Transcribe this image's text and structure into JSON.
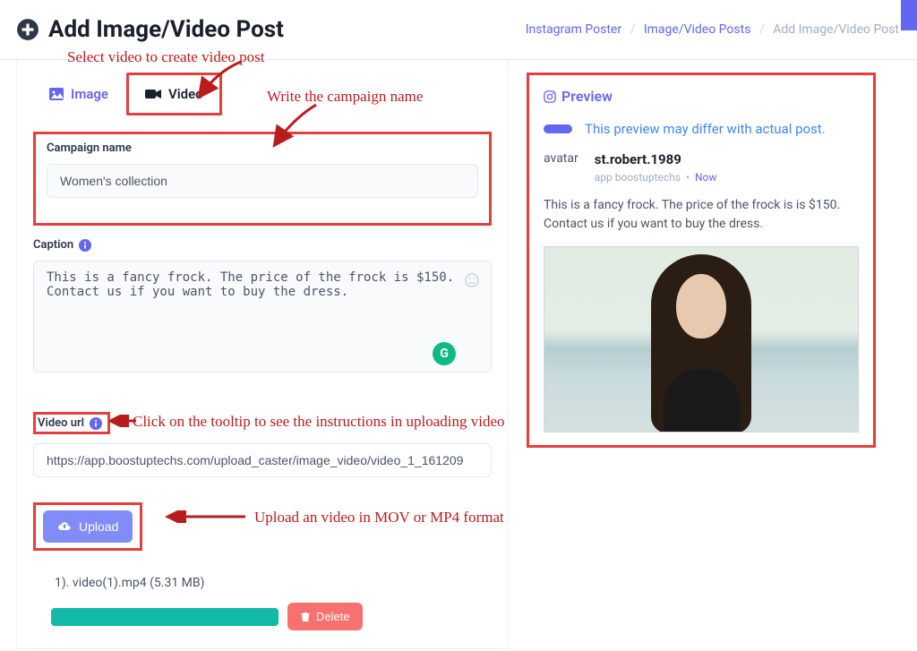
{
  "header": {
    "title": "Add Image/Video Post",
    "breadcrumb": {
      "link1": "Instagram Poster",
      "link2": "Image/Video Posts",
      "current": "Add Image/Video Post"
    }
  },
  "tabs": {
    "image": "Image",
    "video": "Video"
  },
  "form": {
    "campaign_label": "Campaign name",
    "campaign_value": "Women's collection",
    "caption_label": "Caption",
    "caption_value": "This is a fancy frock. The price of the frock is $150. Contact us if you want to buy the dress.",
    "video_url_label": "Video url",
    "video_url_value": "https://app.boostuptechs.com/upload_caster/image_video/video_1_161209",
    "upload_label": "Upload",
    "file_line": "1). video(1).mp4 (5.31 MB)",
    "delete_label": "Delete"
  },
  "preview": {
    "title": "Preview",
    "notice": "This preview may differ with actual post.",
    "avatar_text": "avatar",
    "username": "st.robert.1989",
    "app_text": "app boostuptechs",
    "now_text": "Now",
    "caption": "This is a fancy frock. The price of the frock is is $150. Contact us if you want to buy the dress."
  },
  "annotations": {
    "a1": "Select video to create video post",
    "a2": "Write the campaign name",
    "a3": "Click on the tooltip to see the instructions in uploading video",
    "a4": "Upload an video in MOV or MP4 format"
  }
}
